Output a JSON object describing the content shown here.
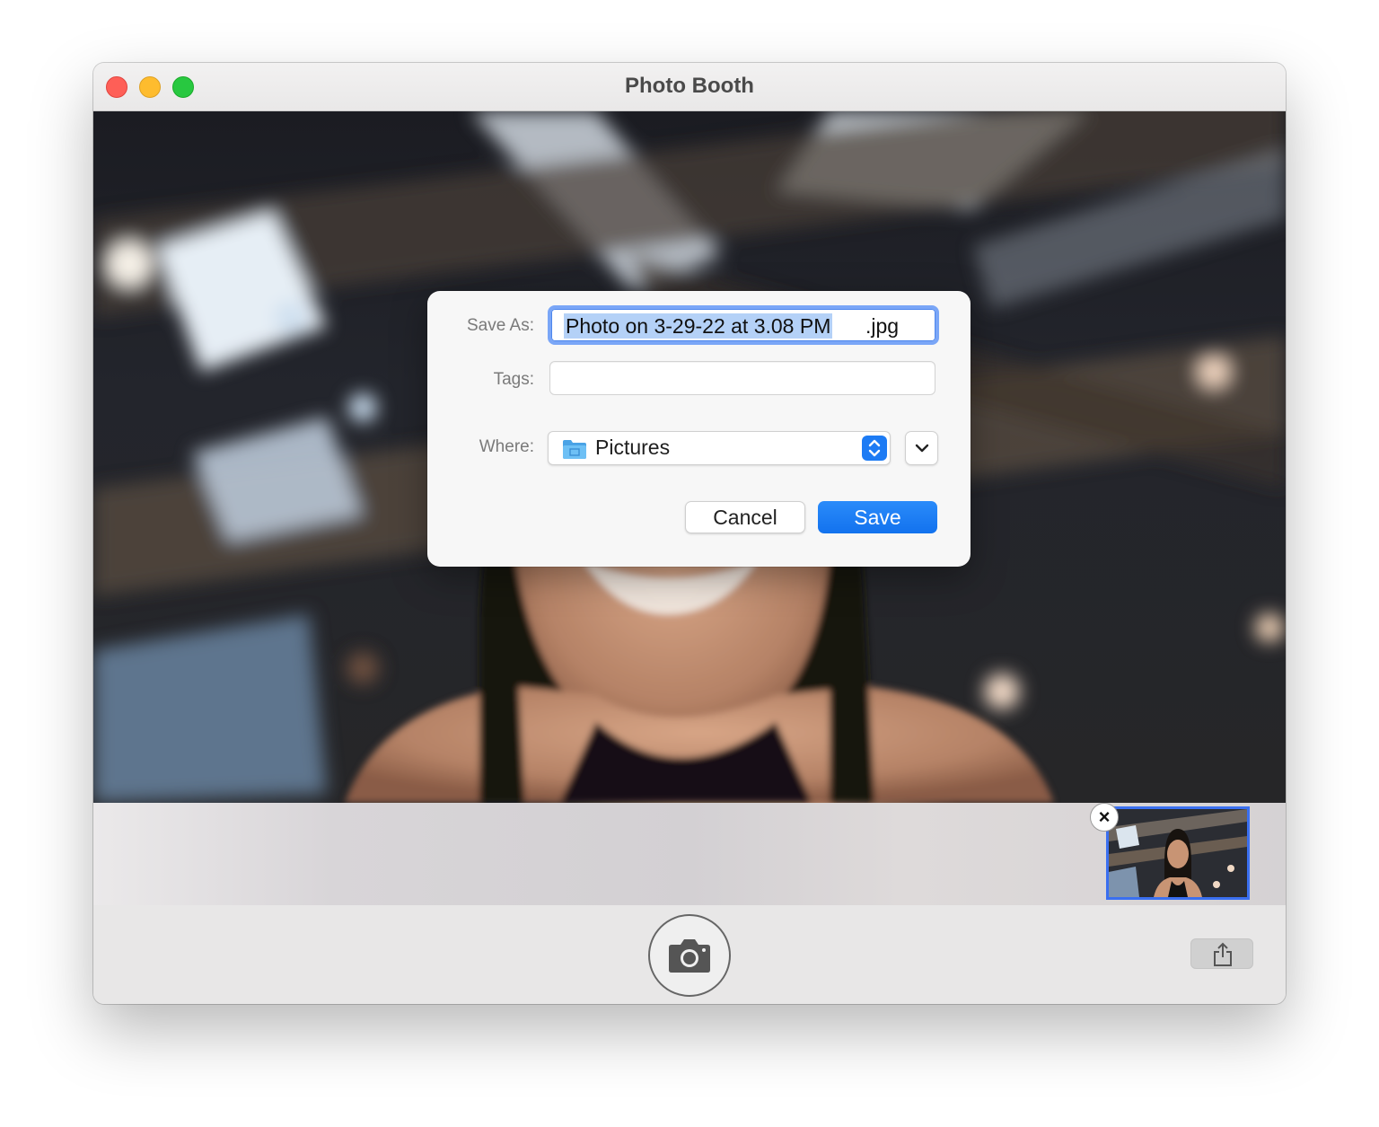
{
  "window": {
    "title": "Photo Booth"
  },
  "dialog": {
    "save_as_label": "Save As:",
    "filename_selected": "Photo on 3-29-22 at 3.08 PM",
    "filename_extension": ".jpg",
    "tags_label": "Tags:",
    "tags_value": "",
    "where_label": "Where:",
    "where_value": "Pictures",
    "cancel_label": "Cancel",
    "save_label": "Save"
  },
  "icons": {
    "thumbnail_close": "×",
    "camera": "camera-icon",
    "share": "share-icon",
    "folder": "folder-icon",
    "stepper": "up-down-chevron-icon",
    "expand": "chevron-down-icon"
  },
  "colors": {
    "accent": "#1d7bf4",
    "selection": "#b4d1f7",
    "focus_ring": "#7aa6f7",
    "close": "#fe5f57",
    "minimize": "#febc2e",
    "maximize": "#28c840",
    "thumbnail_border": "#3a6ff0"
  }
}
